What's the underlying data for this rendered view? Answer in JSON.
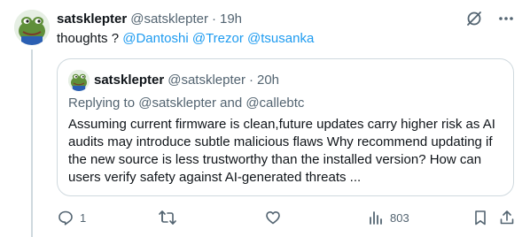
{
  "post": {
    "author_name": "satsklepter",
    "author_handle": "@satsklepter",
    "separator": "·",
    "time": "19h",
    "text_prefix": "thoughts ?",
    "mentions": [
      "@Dantoshi",
      "@Trezor",
      "@tsusanka"
    ]
  },
  "quoted_post": {
    "author_name": "satsklepter",
    "author_handle": "@satsklepter",
    "separator": "·",
    "time": "20h",
    "replying_to": "Replying to @satsklepter and @callebtc",
    "body": "Assuming current firmware is clean,future updates carry higher risk as AI audits may introduce subtle malicious flaws Why recommend updating if the new source is less trustworthy than the installed version? How can users verify safety against AI-generated threats ..."
  },
  "actions": {
    "reply_count": "1",
    "repost_count": "",
    "like_count": "",
    "views_count": "803"
  },
  "colors": {
    "link": "#1d9bf0",
    "muted": "#536471",
    "text": "#0f1419",
    "border": "#cfd9de"
  },
  "icons": {
    "avatar": "frog-avatar",
    "top_left": "grok-slash-icon",
    "top_right": "more-icon",
    "reply": "reply-icon",
    "repost": "repost-icon",
    "like": "like-icon",
    "views": "views-icon",
    "bookmark": "bookmark-icon",
    "share": "share-icon"
  }
}
